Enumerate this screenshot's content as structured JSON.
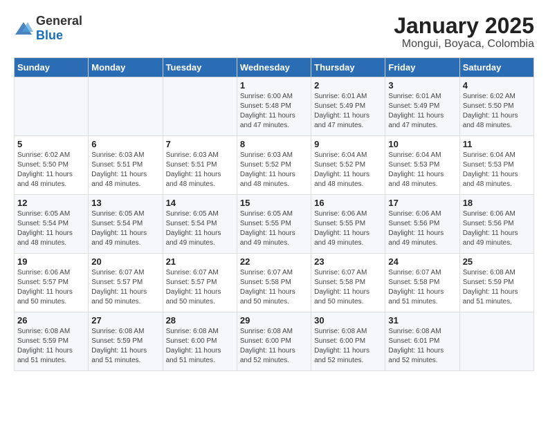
{
  "logo": {
    "general": "General",
    "blue": "Blue"
  },
  "title": "January 2025",
  "subtitle": "Mongui, Boyaca, Colombia",
  "days_of_week": [
    "Sunday",
    "Monday",
    "Tuesday",
    "Wednesday",
    "Thursday",
    "Friday",
    "Saturday"
  ],
  "weeks": [
    [
      {
        "day": "",
        "info": ""
      },
      {
        "day": "",
        "info": ""
      },
      {
        "day": "",
        "info": ""
      },
      {
        "day": "1",
        "info": "Sunrise: 6:00 AM\nSunset: 5:48 PM\nDaylight: 11 hours and 47 minutes."
      },
      {
        "day": "2",
        "info": "Sunrise: 6:01 AM\nSunset: 5:49 PM\nDaylight: 11 hours and 47 minutes."
      },
      {
        "day": "3",
        "info": "Sunrise: 6:01 AM\nSunset: 5:49 PM\nDaylight: 11 hours and 47 minutes."
      },
      {
        "day": "4",
        "info": "Sunrise: 6:02 AM\nSunset: 5:50 PM\nDaylight: 11 hours and 48 minutes."
      }
    ],
    [
      {
        "day": "5",
        "info": "Sunrise: 6:02 AM\nSunset: 5:50 PM\nDaylight: 11 hours and 48 minutes."
      },
      {
        "day": "6",
        "info": "Sunrise: 6:03 AM\nSunset: 5:51 PM\nDaylight: 11 hours and 48 minutes."
      },
      {
        "day": "7",
        "info": "Sunrise: 6:03 AM\nSunset: 5:51 PM\nDaylight: 11 hours and 48 minutes."
      },
      {
        "day": "8",
        "info": "Sunrise: 6:03 AM\nSunset: 5:52 PM\nDaylight: 11 hours and 48 minutes."
      },
      {
        "day": "9",
        "info": "Sunrise: 6:04 AM\nSunset: 5:52 PM\nDaylight: 11 hours and 48 minutes."
      },
      {
        "day": "10",
        "info": "Sunrise: 6:04 AM\nSunset: 5:53 PM\nDaylight: 11 hours and 48 minutes."
      },
      {
        "day": "11",
        "info": "Sunrise: 6:04 AM\nSunset: 5:53 PM\nDaylight: 11 hours and 48 minutes."
      }
    ],
    [
      {
        "day": "12",
        "info": "Sunrise: 6:05 AM\nSunset: 5:54 PM\nDaylight: 11 hours and 48 minutes."
      },
      {
        "day": "13",
        "info": "Sunrise: 6:05 AM\nSunset: 5:54 PM\nDaylight: 11 hours and 49 minutes."
      },
      {
        "day": "14",
        "info": "Sunrise: 6:05 AM\nSunset: 5:54 PM\nDaylight: 11 hours and 49 minutes."
      },
      {
        "day": "15",
        "info": "Sunrise: 6:05 AM\nSunset: 5:55 PM\nDaylight: 11 hours and 49 minutes."
      },
      {
        "day": "16",
        "info": "Sunrise: 6:06 AM\nSunset: 5:55 PM\nDaylight: 11 hours and 49 minutes."
      },
      {
        "day": "17",
        "info": "Sunrise: 6:06 AM\nSunset: 5:56 PM\nDaylight: 11 hours and 49 minutes."
      },
      {
        "day": "18",
        "info": "Sunrise: 6:06 AM\nSunset: 5:56 PM\nDaylight: 11 hours and 49 minutes."
      }
    ],
    [
      {
        "day": "19",
        "info": "Sunrise: 6:06 AM\nSunset: 5:57 PM\nDaylight: 11 hours and 50 minutes."
      },
      {
        "day": "20",
        "info": "Sunrise: 6:07 AM\nSunset: 5:57 PM\nDaylight: 11 hours and 50 minutes."
      },
      {
        "day": "21",
        "info": "Sunrise: 6:07 AM\nSunset: 5:57 PM\nDaylight: 11 hours and 50 minutes."
      },
      {
        "day": "22",
        "info": "Sunrise: 6:07 AM\nSunset: 5:58 PM\nDaylight: 11 hours and 50 minutes."
      },
      {
        "day": "23",
        "info": "Sunrise: 6:07 AM\nSunset: 5:58 PM\nDaylight: 11 hours and 50 minutes."
      },
      {
        "day": "24",
        "info": "Sunrise: 6:07 AM\nSunset: 5:58 PM\nDaylight: 11 hours and 51 minutes."
      },
      {
        "day": "25",
        "info": "Sunrise: 6:08 AM\nSunset: 5:59 PM\nDaylight: 11 hours and 51 minutes."
      }
    ],
    [
      {
        "day": "26",
        "info": "Sunrise: 6:08 AM\nSunset: 5:59 PM\nDaylight: 11 hours and 51 minutes."
      },
      {
        "day": "27",
        "info": "Sunrise: 6:08 AM\nSunset: 5:59 PM\nDaylight: 11 hours and 51 minutes."
      },
      {
        "day": "28",
        "info": "Sunrise: 6:08 AM\nSunset: 6:00 PM\nDaylight: 11 hours and 51 minutes."
      },
      {
        "day": "29",
        "info": "Sunrise: 6:08 AM\nSunset: 6:00 PM\nDaylight: 11 hours and 52 minutes."
      },
      {
        "day": "30",
        "info": "Sunrise: 6:08 AM\nSunset: 6:00 PM\nDaylight: 11 hours and 52 minutes."
      },
      {
        "day": "31",
        "info": "Sunrise: 6:08 AM\nSunset: 6:01 PM\nDaylight: 11 hours and 52 minutes."
      },
      {
        "day": "",
        "info": ""
      }
    ]
  ]
}
